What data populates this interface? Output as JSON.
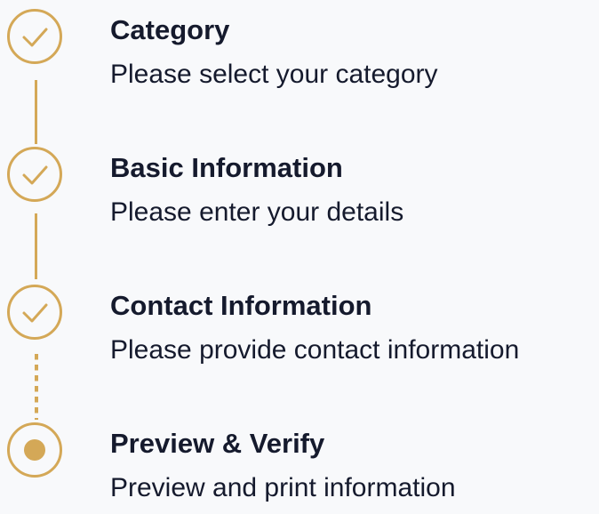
{
  "accent_color": "#d4a857",
  "text_color": "#151a2d",
  "steps": [
    {
      "title": "Category",
      "subtitle": "Please select your category",
      "status": "completed",
      "icon": "check-icon"
    },
    {
      "title": "Basic Information",
      "subtitle": "Please enter your details",
      "status": "completed",
      "icon": "check-icon"
    },
    {
      "title": "Contact Information",
      "subtitle": "Please provide contact information",
      "status": "completed",
      "icon": "check-icon"
    },
    {
      "title": "Preview & Verify",
      "subtitle": "Preview and print information",
      "status": "current",
      "icon": "current-step-dot-icon"
    }
  ]
}
